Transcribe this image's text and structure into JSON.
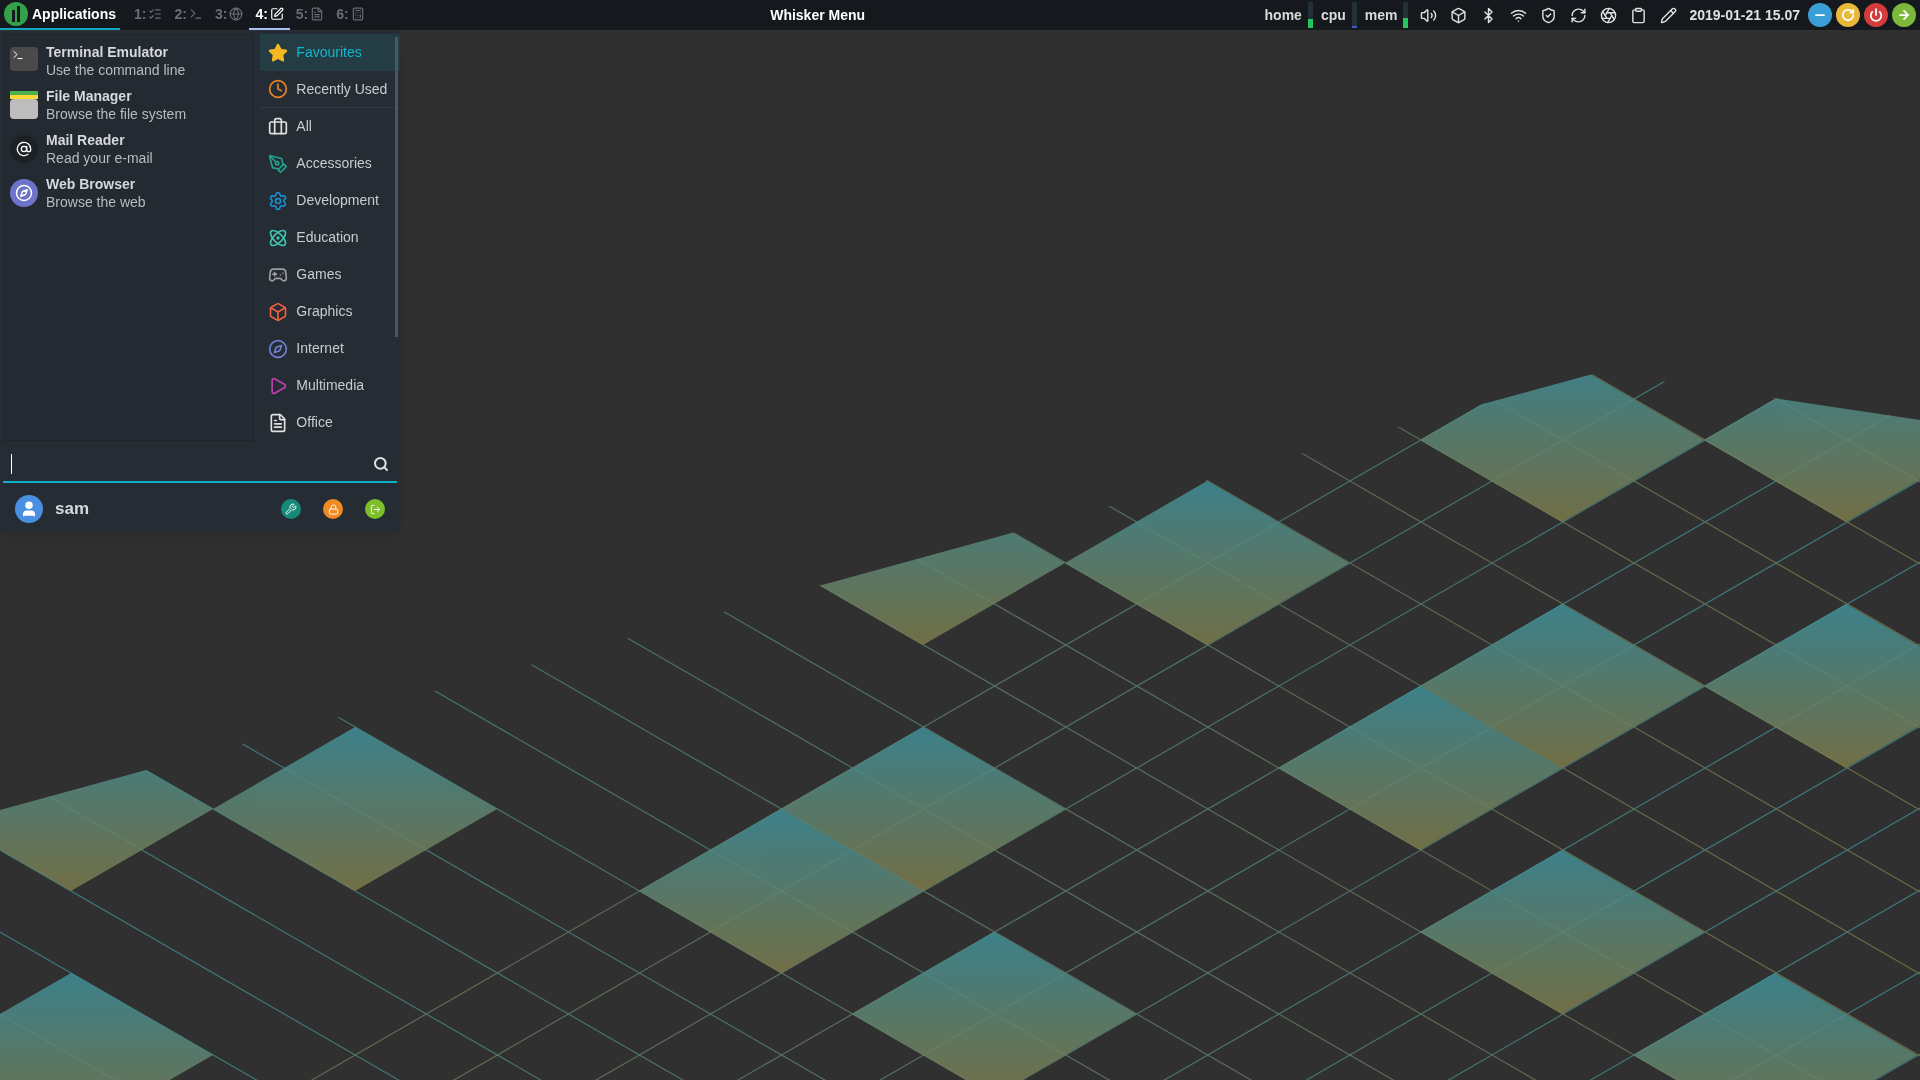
{
  "top_panel": {
    "applications_button": {
      "label": "Applications",
      "selected": true
    },
    "workspaces": [
      {
        "label": "1:",
        "selected": false
      },
      {
        "label": "2:",
        "selected": false
      },
      {
        "label": "3:",
        "selected": false
      },
      {
        "label": "4:",
        "selected": true
      },
      {
        "label": "5:",
        "selected": false
      },
      {
        "label": "6:",
        "selected": false
      }
    ],
    "window_title": "Whisker Menu",
    "monitors": [
      {
        "label": "home",
        "level": 0.35,
        "color": "#22c55e"
      },
      {
        "label": "cpu",
        "level": 0.08,
        "color": "#3b5bdb"
      },
      {
        "label": "mem",
        "level": 0.4,
        "color": "#22c55e"
      }
    ],
    "clock": "2019-01-21 15.07"
  },
  "whisker_menu": {
    "favourites": [
      {
        "title": "Terminal Emulator",
        "description": "Use the command line"
      },
      {
        "title": "File Manager",
        "description": "Browse the file system"
      },
      {
        "title": "Mail Reader",
        "description": "Read your e-mail"
      },
      {
        "title": "Web Browser",
        "description": "Browse the web"
      }
    ],
    "categories": [
      {
        "label": "Favourites",
        "selected": true
      },
      {
        "label": "Recently Used",
        "selected": false
      },
      {
        "label": "All",
        "selected": false
      },
      {
        "label": "Accessories",
        "selected": false
      },
      {
        "label": "Development",
        "selected": false
      },
      {
        "label": "Education",
        "selected": false
      },
      {
        "label": "Games",
        "selected": false
      },
      {
        "label": "Graphics",
        "selected": false
      },
      {
        "label": "Internet",
        "selected": false
      },
      {
        "label": "Multimedia",
        "selected": false
      },
      {
        "label": "Office",
        "selected": false
      }
    ],
    "user": "sam"
  }
}
